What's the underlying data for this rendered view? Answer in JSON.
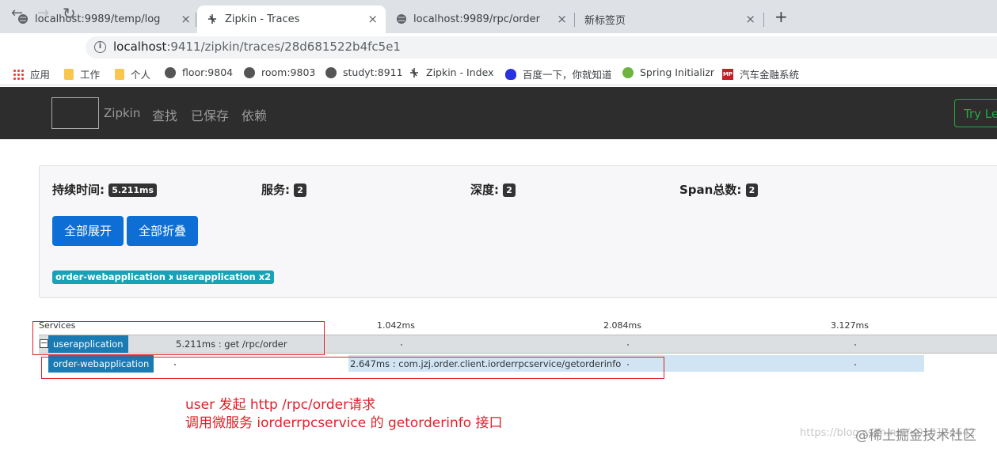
{
  "tabs": [
    {
      "title": "localhost:9989/temp/log",
      "close": "×"
    },
    {
      "title": "Zipkin - Traces",
      "close": "×"
    },
    {
      "title": "localhost:9989/rpc/order",
      "close": "×"
    },
    {
      "title": "新标签页",
      "close": "×"
    }
  ],
  "new_tab": "+",
  "toolbar": {
    "back": "←",
    "forward": "→",
    "reload": "↻",
    "info": "i",
    "url_host": "localhost",
    "url_rest": ":9411/zipkin/traces/28d681522b4fc5e1"
  },
  "bookmarks": [
    {
      "label": "应用",
      "icon": "apps-grid-icon"
    },
    {
      "label": "工作",
      "icon": "folder-icon"
    },
    {
      "label": "个人",
      "icon": "folder-icon"
    },
    {
      "label": "floor:9804",
      "icon": "globe-icon"
    },
    {
      "label": "room:9803",
      "icon": "globe-icon"
    },
    {
      "label": "studyt:8911",
      "icon": "globe-icon"
    },
    {
      "label": "Zipkin - Index",
      "icon": "zipkin-icon"
    },
    {
      "label": "百度一下，你就知道",
      "icon": "baidu-icon"
    },
    {
      "label": "Spring Initializr",
      "icon": "spring-icon"
    },
    {
      "label": "汽车金融系统",
      "icon": "mp-icon"
    }
  ],
  "navbar": {
    "brand": "Zipkin",
    "links": [
      "查找",
      "已保存",
      "依赖"
    ],
    "try_button": "Try Le"
  },
  "summary": {
    "duration_label": "持续时间:",
    "duration_value": "5.211ms",
    "services_label": "服务:",
    "services_value": "2",
    "depth_label": "深度:",
    "depth_value": "2",
    "spans_label": "Span总数:",
    "spans_value": "2",
    "expand_all": "全部展开",
    "collapse_all": "全部折叠",
    "service_badges": [
      "order-webapplication x1",
      "userapplication x2"
    ]
  },
  "timeline": {
    "services_header": "Services",
    "ticks": [
      "1.042ms",
      "2.084ms",
      "3.127ms"
    ],
    "expand_toggle": "−",
    "rows": [
      {
        "service": "userapplication",
        "label": "5.211ms : get /rpc/order"
      },
      {
        "service": "order-webapplication",
        "label": "2.647ms : com.jzj.order.client.iorderrpcservice/getorderinfo"
      }
    ]
  },
  "annotations": [
    "user 发起 http /rpc/order请求",
    "调用微服务 iorderrpcservice 的 getorderinfo 接口"
  ],
  "watermark": "https://blog.csdn.net/u010134642",
  "watermark_brand": "@稀土掘金技术社区",
  "colors": {
    "accent_blue": "#0d6fd6",
    "badge_teal": "#17a2b8",
    "span_blue": "#1a7bb3",
    "annotation_red": "#e0202a"
  }
}
